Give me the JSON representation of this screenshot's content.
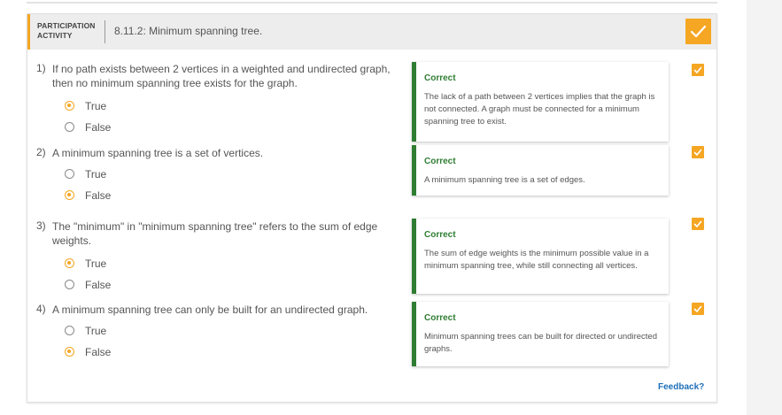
{
  "activity": {
    "type_label": "PARTICIPATION ACTIVITY",
    "title": "8.11.2: Minimum spanning tree."
  },
  "questions": [
    {
      "number": "1)",
      "text": "If no path exists between 2 vertices in a weighted and undirected graph, then no minimum spanning tree exists for the graph.",
      "options": [
        "True",
        "False"
      ],
      "selected": "True",
      "feedback_title": "Correct",
      "feedback_text": "The lack of a path between 2 vertices implies that the graph is not connected. A graph must be connected for a minimum spanning tree to exist."
    },
    {
      "number": "2)",
      "text": "A minimum spanning tree is a set of vertices.",
      "options": [
        "True",
        "False"
      ],
      "selected": "False",
      "feedback_title": "Correct",
      "feedback_text": "A minimum spanning tree is a set of edges."
    },
    {
      "number": "3)",
      "text": "The \"minimum\" in \"minimum spanning tree\" refers to the sum of edge weights.",
      "options": [
        "True",
        "False"
      ],
      "selected": "True",
      "feedback_title": "Correct",
      "feedback_text": "The sum of edge weights is the minimum possible value in a minimum spanning tree, while still connecting all vertices."
    },
    {
      "number": "4)",
      "text": "A minimum spanning tree can only be built for an undirected graph.",
      "options": [
        "True",
        "False"
      ],
      "selected": "False",
      "feedback_title": "Correct",
      "feedback_text": "Minimum spanning trees can be built for directed or undirected graphs."
    }
  ],
  "feedback_link": "Feedback?",
  "colors": {
    "accent": "#f5a623",
    "correct": "#2e7d32",
    "link": "#1e6fb8"
  },
  "icons": {
    "completion": "checkmark-icon"
  }
}
